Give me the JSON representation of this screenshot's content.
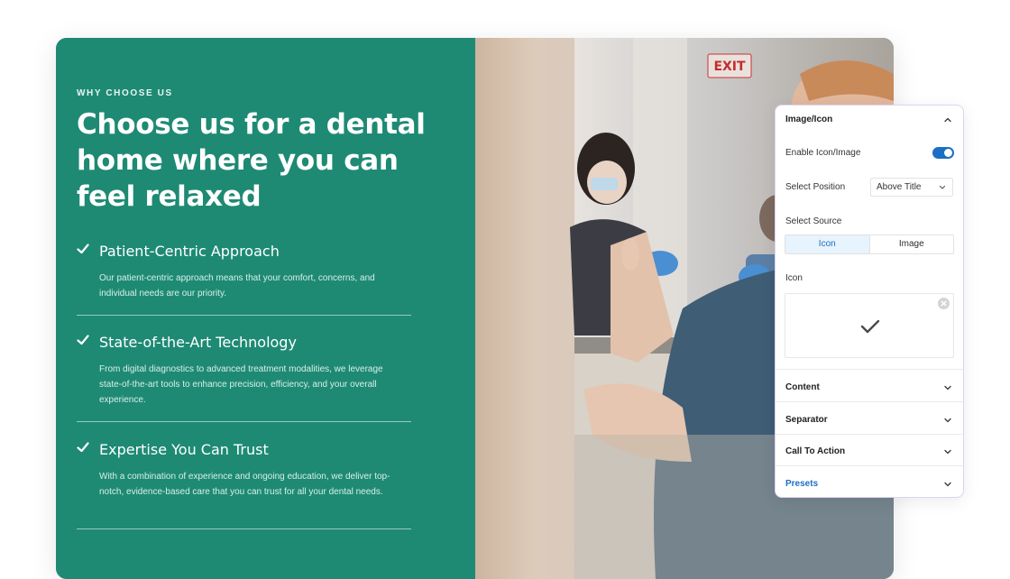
{
  "hero": {
    "eyebrow": "WHY CHOOSE US",
    "headline_lines": [
      "Choose us for a dental",
      "home where you can",
      "feel relaxed"
    ]
  },
  "features": [
    {
      "title": "Patient-Centric Approach",
      "description": "Our patient-centric approach means that your comfort, concerns, and individual needs are our priority.",
      "icon": "check-icon"
    },
    {
      "title": "State-of-the-Art Technology",
      "description": "From digital diagnostics to advanced treatment modalities, we leverage state-of-the-art tools to enhance precision, efficiency, and your overall experience.",
      "icon": "check-icon"
    },
    {
      "title": "Expertise You Can Trust",
      "description": "With a combination of experience and ongoing education, we deliver top-notch, evidence-based care that you can trust for all your dental needs.",
      "icon": "check-icon"
    }
  ],
  "photo": {
    "sign_text": "EXIT"
  },
  "panel": {
    "section_title": "Image/Icon",
    "enable_label": "Enable Icon/Image",
    "enable_value": true,
    "position_label": "Select Position",
    "position_value": "Above Title",
    "source_label": "Select Source",
    "source_options": [
      "Icon",
      "Image"
    ],
    "source_selected": "Icon",
    "icon_label": "Icon",
    "icon_value": "check-icon",
    "collapsed_sections": [
      "Content",
      "Separator",
      "Call To Action",
      "Presets"
    ]
  },
  "colors": {
    "brand_green": "#1e8a74",
    "accent_blue": "#1d6fc4",
    "panel_border": "#dcd3f2"
  }
}
